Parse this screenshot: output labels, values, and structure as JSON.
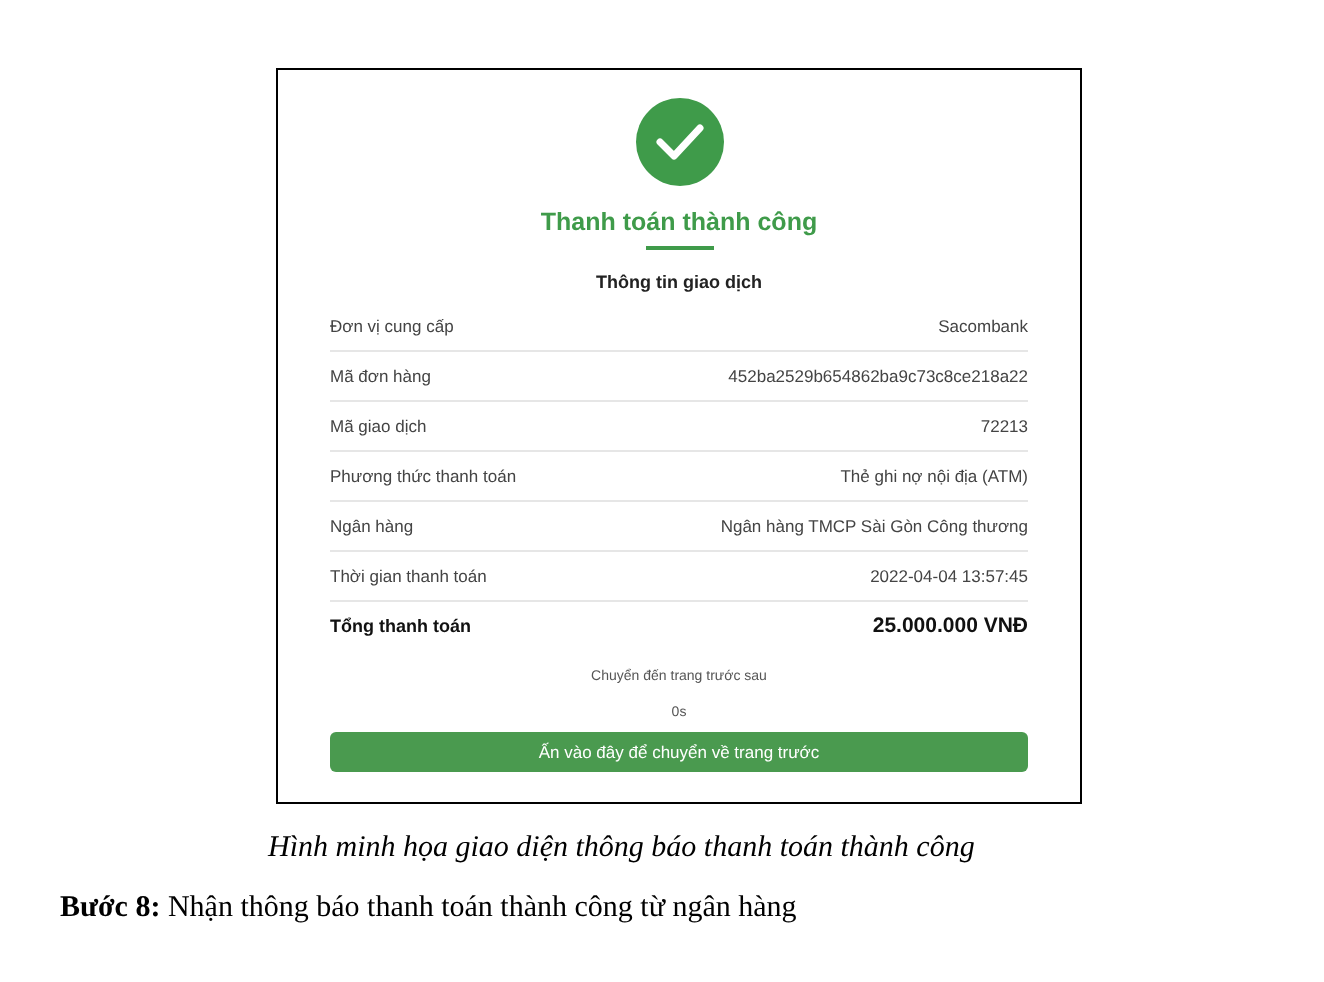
{
  "screen": {
    "title": "Thanh toán thành công",
    "section_title": "Thông tin giao dịch",
    "rows": [
      {
        "label": "Đơn vị cung cấp",
        "value": "Sacombank"
      },
      {
        "label": "Mã đơn hàng",
        "value": "452ba2529b654862ba9c73c8ce218a22"
      },
      {
        "label": "Mã giao dịch",
        "value": "72213"
      },
      {
        "label": "Phương thức thanh toán",
        "value": "Thẻ ghi nợ nội địa (ATM)"
      },
      {
        "label": "Ngân hàng",
        "value": "Ngân hàng TMCP Sài Gòn Công thương"
      },
      {
        "label": "Thời gian thanh toán",
        "value": "2022-04-04 13:57:45"
      }
    ],
    "total": {
      "label": "Tổng thanh toán",
      "value": "25.000.000 VNĐ"
    },
    "redirect_note": "Chuyển đến trang trước sau",
    "countdown": "0s",
    "button": "Ấn vào đây để chuyển về trang trước"
  },
  "caption": "Hình minh họa giao diện thông báo thanh toán thành công",
  "step": "**Bước 8:** Nhận thông báo thanh toán thành công từ ngân hàng"
}
